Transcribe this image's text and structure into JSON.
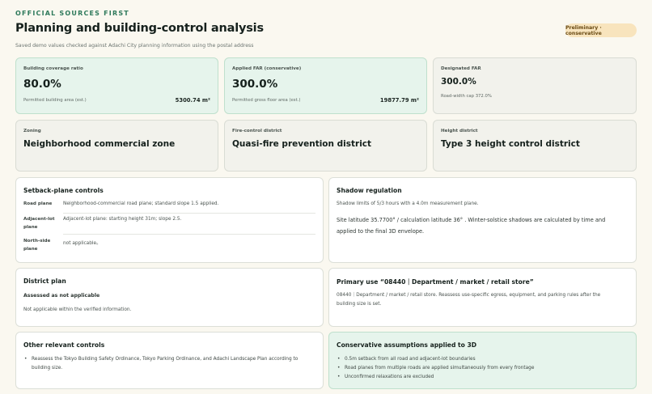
{
  "header": {
    "eyebrow": "OFFICIAL SOURCES FIRST",
    "title": "Planning and building-control analysis",
    "subtitle": "Saved demo values checked against Adachi City planning information using the postal address",
    "badge": "Preliminary · conservative"
  },
  "metrics": [
    {
      "label": "Building coverage ratio",
      "value": "80.0%",
      "foot_label": "Permitted building area (est.)",
      "foot_value": "5300.74 m²"
    },
    {
      "label": "Applied FAR (conservative)",
      "value": "300.0%",
      "foot_label": "Permitted gross floor area (est.)",
      "foot_value": "19877.79 m²"
    },
    {
      "label": "Designated FAR",
      "value": "300.0%",
      "foot_label": "Road-width cap 372.0%"
    }
  ],
  "zones": [
    {
      "label": "Zoning",
      "value": "Neighborhood commercial zone"
    },
    {
      "label": "Fire-control district",
      "value": "Quasi-fire prevention district"
    },
    {
      "label": "Height district",
      "value": "Type 3 height control district"
    }
  ],
  "setback": {
    "title": "Setback-plane controls",
    "rows": [
      {
        "label": "Road plane",
        "value": "Neighborhood-commercial road plane; standard slope 1.5 applied."
      },
      {
        "label": "Adjacent-lot plane",
        "value": "Adjacent-lot plane: starting height 31m; slope 2.5."
      },
      {
        "label": "North-side plane",
        "value": "not applicable。"
      }
    ]
  },
  "shadow": {
    "title": "Shadow regulation",
    "line1": "Shadow limits of 5/3 hours with a 4.0m measurement plane.",
    "line2": "Site latitude 35.7700°  / calculation latitude 36° . Winter-solstice shadows are calculated by time and",
    "line3": "applied to the final 3D envelope."
  },
  "district": {
    "title": "District plan",
    "status": "Assessed as not applicable",
    "text": "Not applicable within the verified information."
  },
  "primary_use": {
    "title": "Primary use “08440｜Department / market / retail store”",
    "line1": "08440｜Department / market / retail store. Reassess use-specific egress, equipment, and parking rules after the",
    "line2": "building size is set."
  },
  "other": {
    "title": "Other relevant controls",
    "items": [
      {
        "line1": "Reassess the Tokyo Building Safety Ordinance, Tokyo Parking Ordinance, and Adachi Landscape Plan according to",
        "line2": "building size."
      }
    ]
  },
  "assumptions": {
    "title": "Conservative assumptions applied to 3D",
    "items": [
      "0.5m setback from all road and adjacent-lot boundaries",
      "Road planes from multiple roads are applied simultaneously from every frontage",
      "Unconfirmed relaxations are excluded"
    ]
  }
}
